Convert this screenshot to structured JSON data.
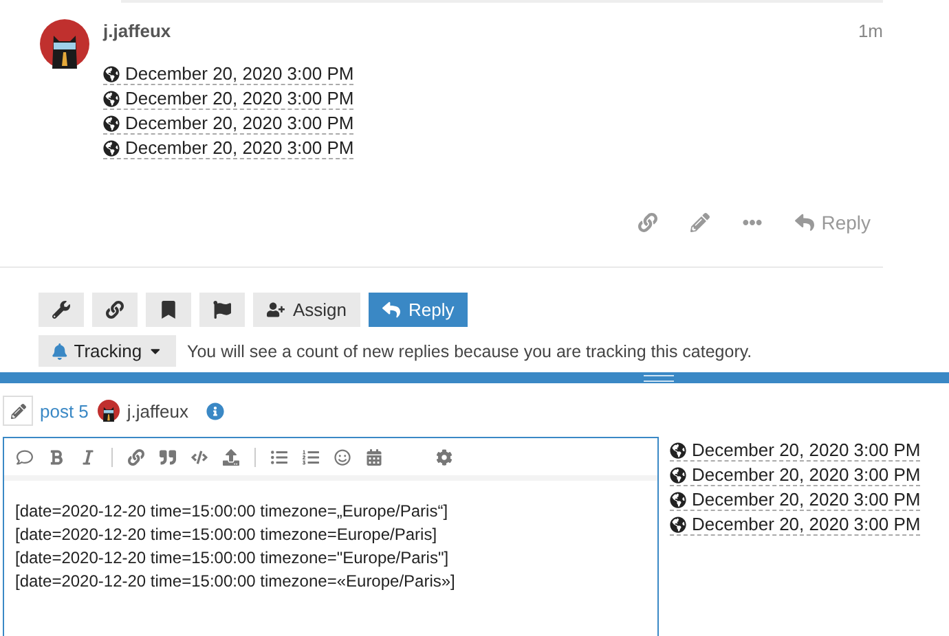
{
  "post": {
    "username": "j.jaffeux",
    "age": "1m",
    "dates": [
      "December 20, 2020 3:00 PM",
      "December 20, 2020 3:00 PM",
      "December 20, 2020 3:00 PM",
      "December 20, 2020 3:00 PM"
    ],
    "reply_label": "Reply"
  },
  "topic_buttons": [
    {
      "kind": "wrench"
    },
    {
      "kind": "link"
    },
    {
      "kind": "bookmark"
    },
    {
      "kind": "flag"
    },
    {
      "kind": "assign",
      "label": "Assign"
    },
    {
      "kind": "reply",
      "label": "Reply"
    }
  ],
  "notification": {
    "level": "Tracking",
    "description": "You will see a count of new replies because you are tracking this category."
  },
  "composer": {
    "reply_to": "post 5",
    "username": "j.jaffeux",
    "toolbar": [
      {
        "kind": "quote"
      },
      {
        "kind": "bold"
      },
      {
        "kind": "italic"
      },
      {
        "kind": "separator"
      },
      {
        "kind": "link"
      },
      {
        "kind": "blockquote"
      },
      {
        "kind": "code"
      },
      {
        "kind": "upload"
      },
      {
        "kind": "separator"
      },
      {
        "kind": "bullet"
      },
      {
        "kind": "numbered"
      },
      {
        "kind": "emoji"
      },
      {
        "kind": "calendar"
      },
      {
        "kind": "options"
      }
    ],
    "lines": [
      "[date=2020-12-20 time=15:00:00 timezone=„Europe/Paris“]",
      "[date=2020-12-20 time=15:00:00 timezone=Europe/Paris]",
      "[date=2020-12-20 time=15:00:00 timezone=\"Europe/Paris\"]",
      "[date=2020-12-20 time=15:00:00 timezone=«Europe/Paris»]"
    ],
    "preview": [
      "December 20, 2020 3:00 PM",
      "December 20, 2020 3:00 PM",
      "December 20, 2020 3:00 PM",
      "December 20, 2020 3:00 PM"
    ]
  }
}
